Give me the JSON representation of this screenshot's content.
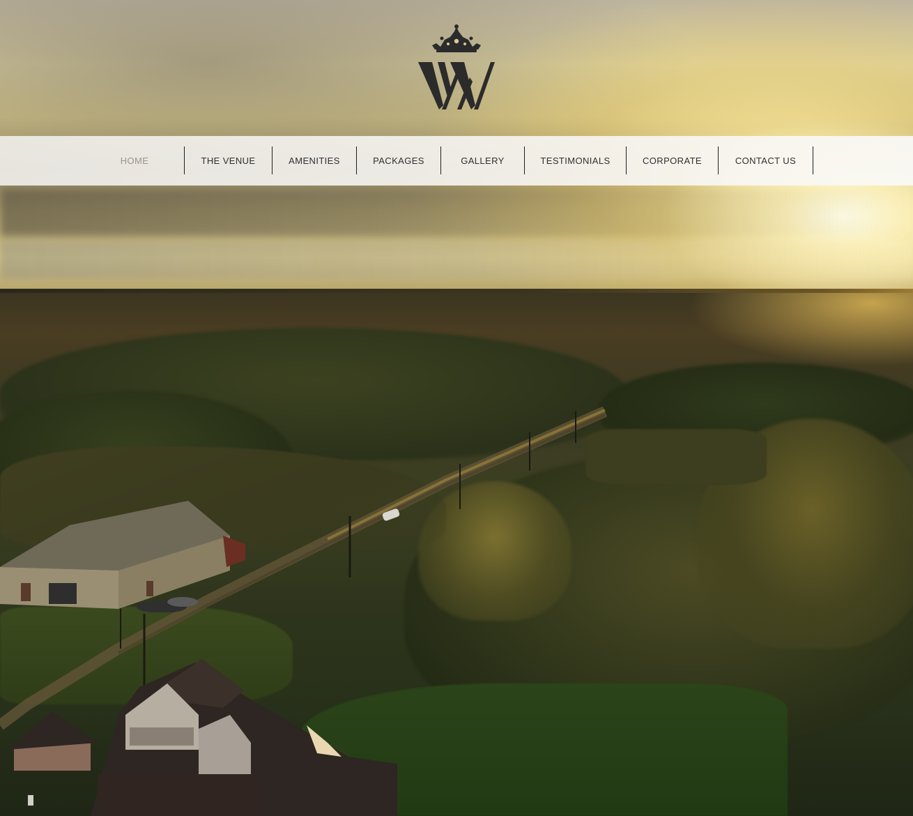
{
  "brand": {
    "logo_monogram": "WV",
    "logo_icon": "crown-icon"
  },
  "nav": {
    "items": [
      {
        "label": "HOME",
        "active": true
      },
      {
        "label": "THE VENUE",
        "active": false
      },
      {
        "label": "AMENITIES",
        "active": false
      },
      {
        "label": "PACKAGES",
        "active": false
      },
      {
        "label": "GALLERY",
        "active": false
      },
      {
        "label": "TESTIMONIALS",
        "active": false
      },
      {
        "label": "CORPORATE",
        "active": false
      },
      {
        "label": "CONTACT US",
        "active": false
      }
    ]
  },
  "hero": {
    "background": "aerial-sunset-landscape-image"
  },
  "colors": {
    "nav_background": "#f2f0ec",
    "nav_text": "#2f2f2f",
    "nav_active_text": "#9a9388",
    "nav_divider": "#1e1e1e",
    "logo": "#2b2b2b"
  }
}
